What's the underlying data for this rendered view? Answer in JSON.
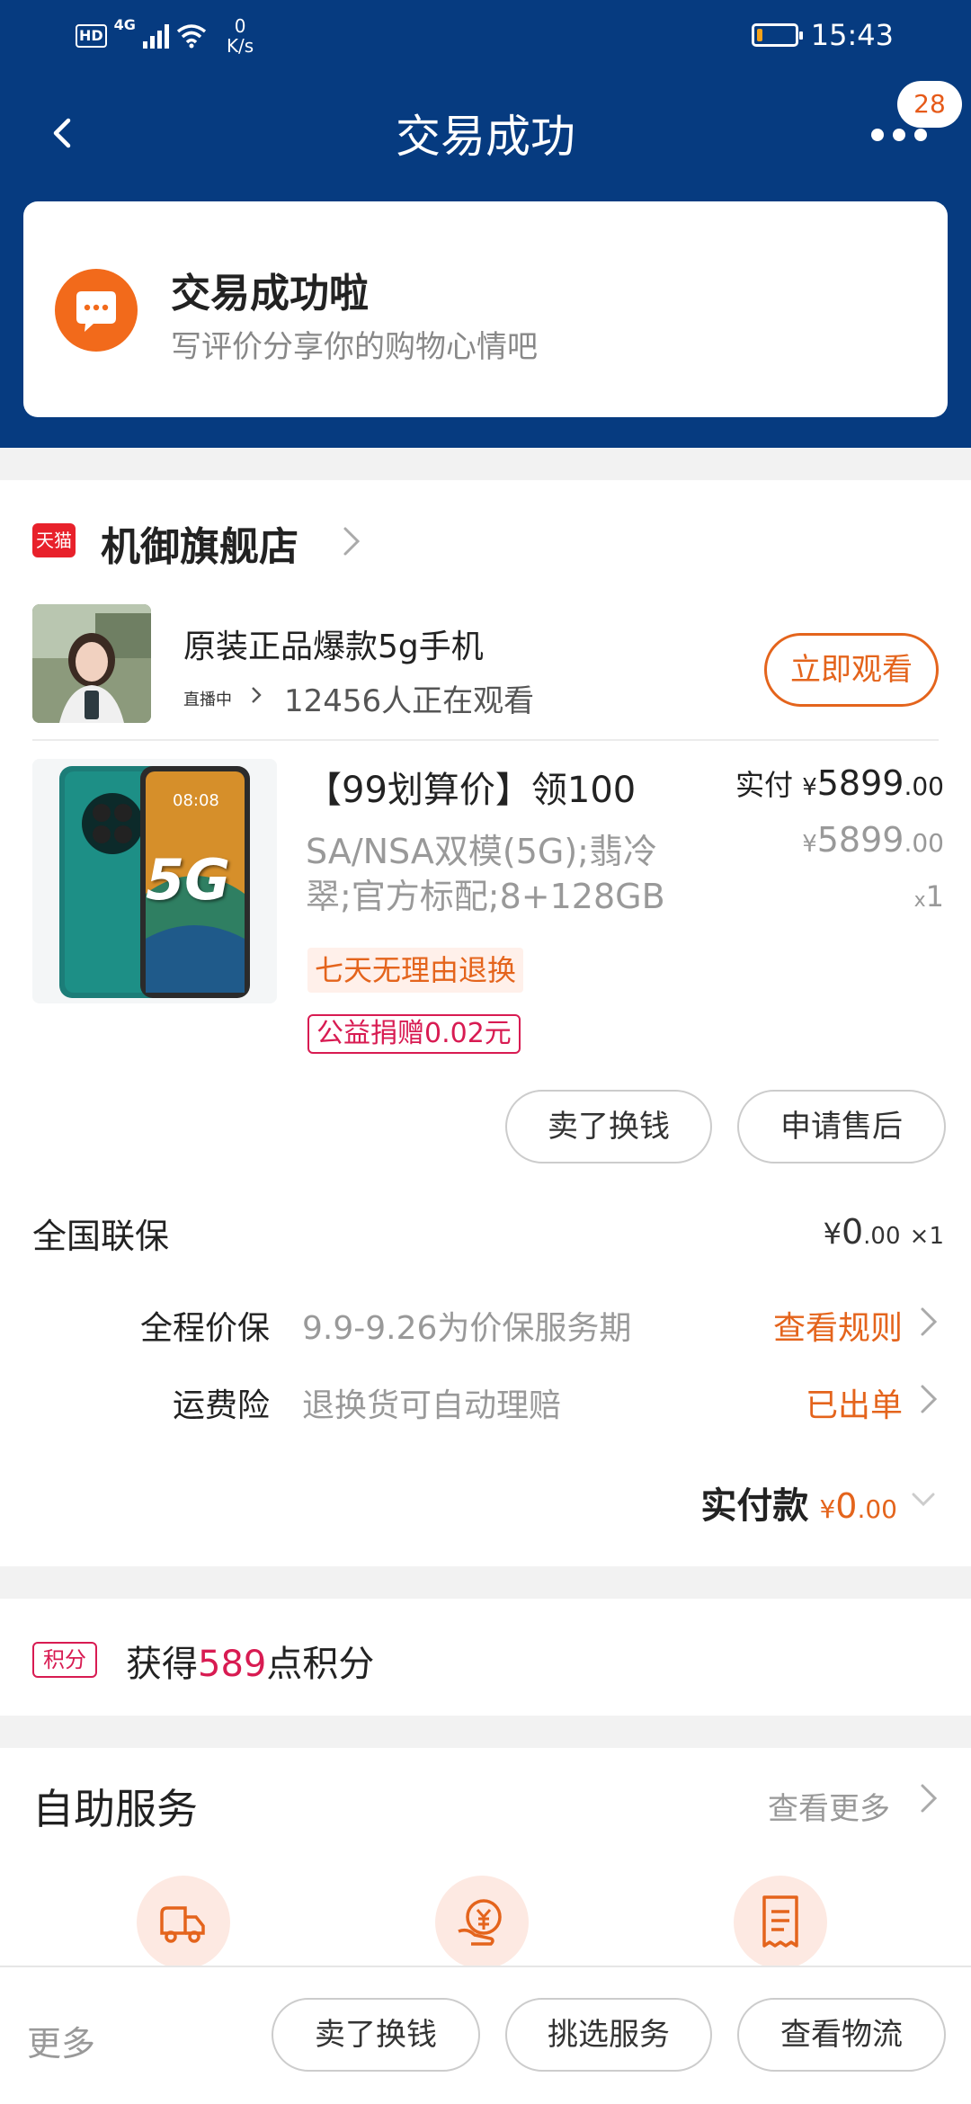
{
  "status_bar": {
    "hd": "HD",
    "net_type": "4G",
    "net_speed_value": "0",
    "net_speed_unit": "K/s",
    "time": "15:43",
    "battery_level": 0.15,
    "battery_color": "#f6a21a"
  },
  "header": {
    "title": "交易成功",
    "back_icon": "chevron-left-icon",
    "more_icon": "more-dots-icon",
    "message_badge": "28"
  },
  "success_banner": {
    "icon": "chat-bubble-icon",
    "title": "交易成功啦",
    "subtitle": "写评价分享你的购物心情吧"
  },
  "store": {
    "badge": "天猫",
    "name": "机御旗舰店"
  },
  "live": {
    "title": "原装正品爆款5g手机",
    "tag": "直播中",
    "viewers": "12456人正在观看",
    "watch_button": "立即观看"
  },
  "product": {
    "image_text": "5G",
    "screen_time": "08:08",
    "title": "【99划算价】领100",
    "spec": "SA/NSA双模(5G);翡冷翠;官方标配;8+128GB",
    "tag_return": "七天无理由退换",
    "tag_charity": "公益捐赠0.02元",
    "paid_label": "实付",
    "currency": "¥",
    "paid_int": "5899",
    "paid_dec": ".00",
    "orig_int": "5899",
    "orig_dec": ".00",
    "qty_x": "x",
    "qty": "1"
  },
  "item_actions": {
    "sell": "卖了换钱",
    "after_sale": "申请售后"
  },
  "warranty": {
    "label": "全国联保",
    "currency": "¥",
    "price_int": "0",
    "price_dec": ".00",
    "qty": "×1"
  },
  "services": [
    {
      "label": "全程价保",
      "desc": "9.9-9.26为价保服务期",
      "action": "查看规则"
    },
    {
      "label": "运费险",
      "desc": "退换货可自动理赔",
      "action": "已出单"
    }
  ],
  "total": {
    "label": "实付款",
    "currency": "¥",
    "int": "0",
    "dec": ".00"
  },
  "points": {
    "badge": "积分",
    "prefix": "获得",
    "amount": "589",
    "suffix": "点积分"
  },
  "self_service": {
    "title": "自助服务",
    "more": "查看更多",
    "icons": [
      "delivery-truck-icon",
      "refund-yen-icon",
      "receipt-icon"
    ]
  },
  "bottom_bar": {
    "more": "更多",
    "buttons": [
      "卖了换钱",
      "挑选服务",
      "查看物流"
    ]
  },
  "colors": {
    "header_bg": "#063b80",
    "accent_orange": "#e4641c",
    "accent_red": "#d81b52",
    "tmall_red": "#e8212b"
  }
}
